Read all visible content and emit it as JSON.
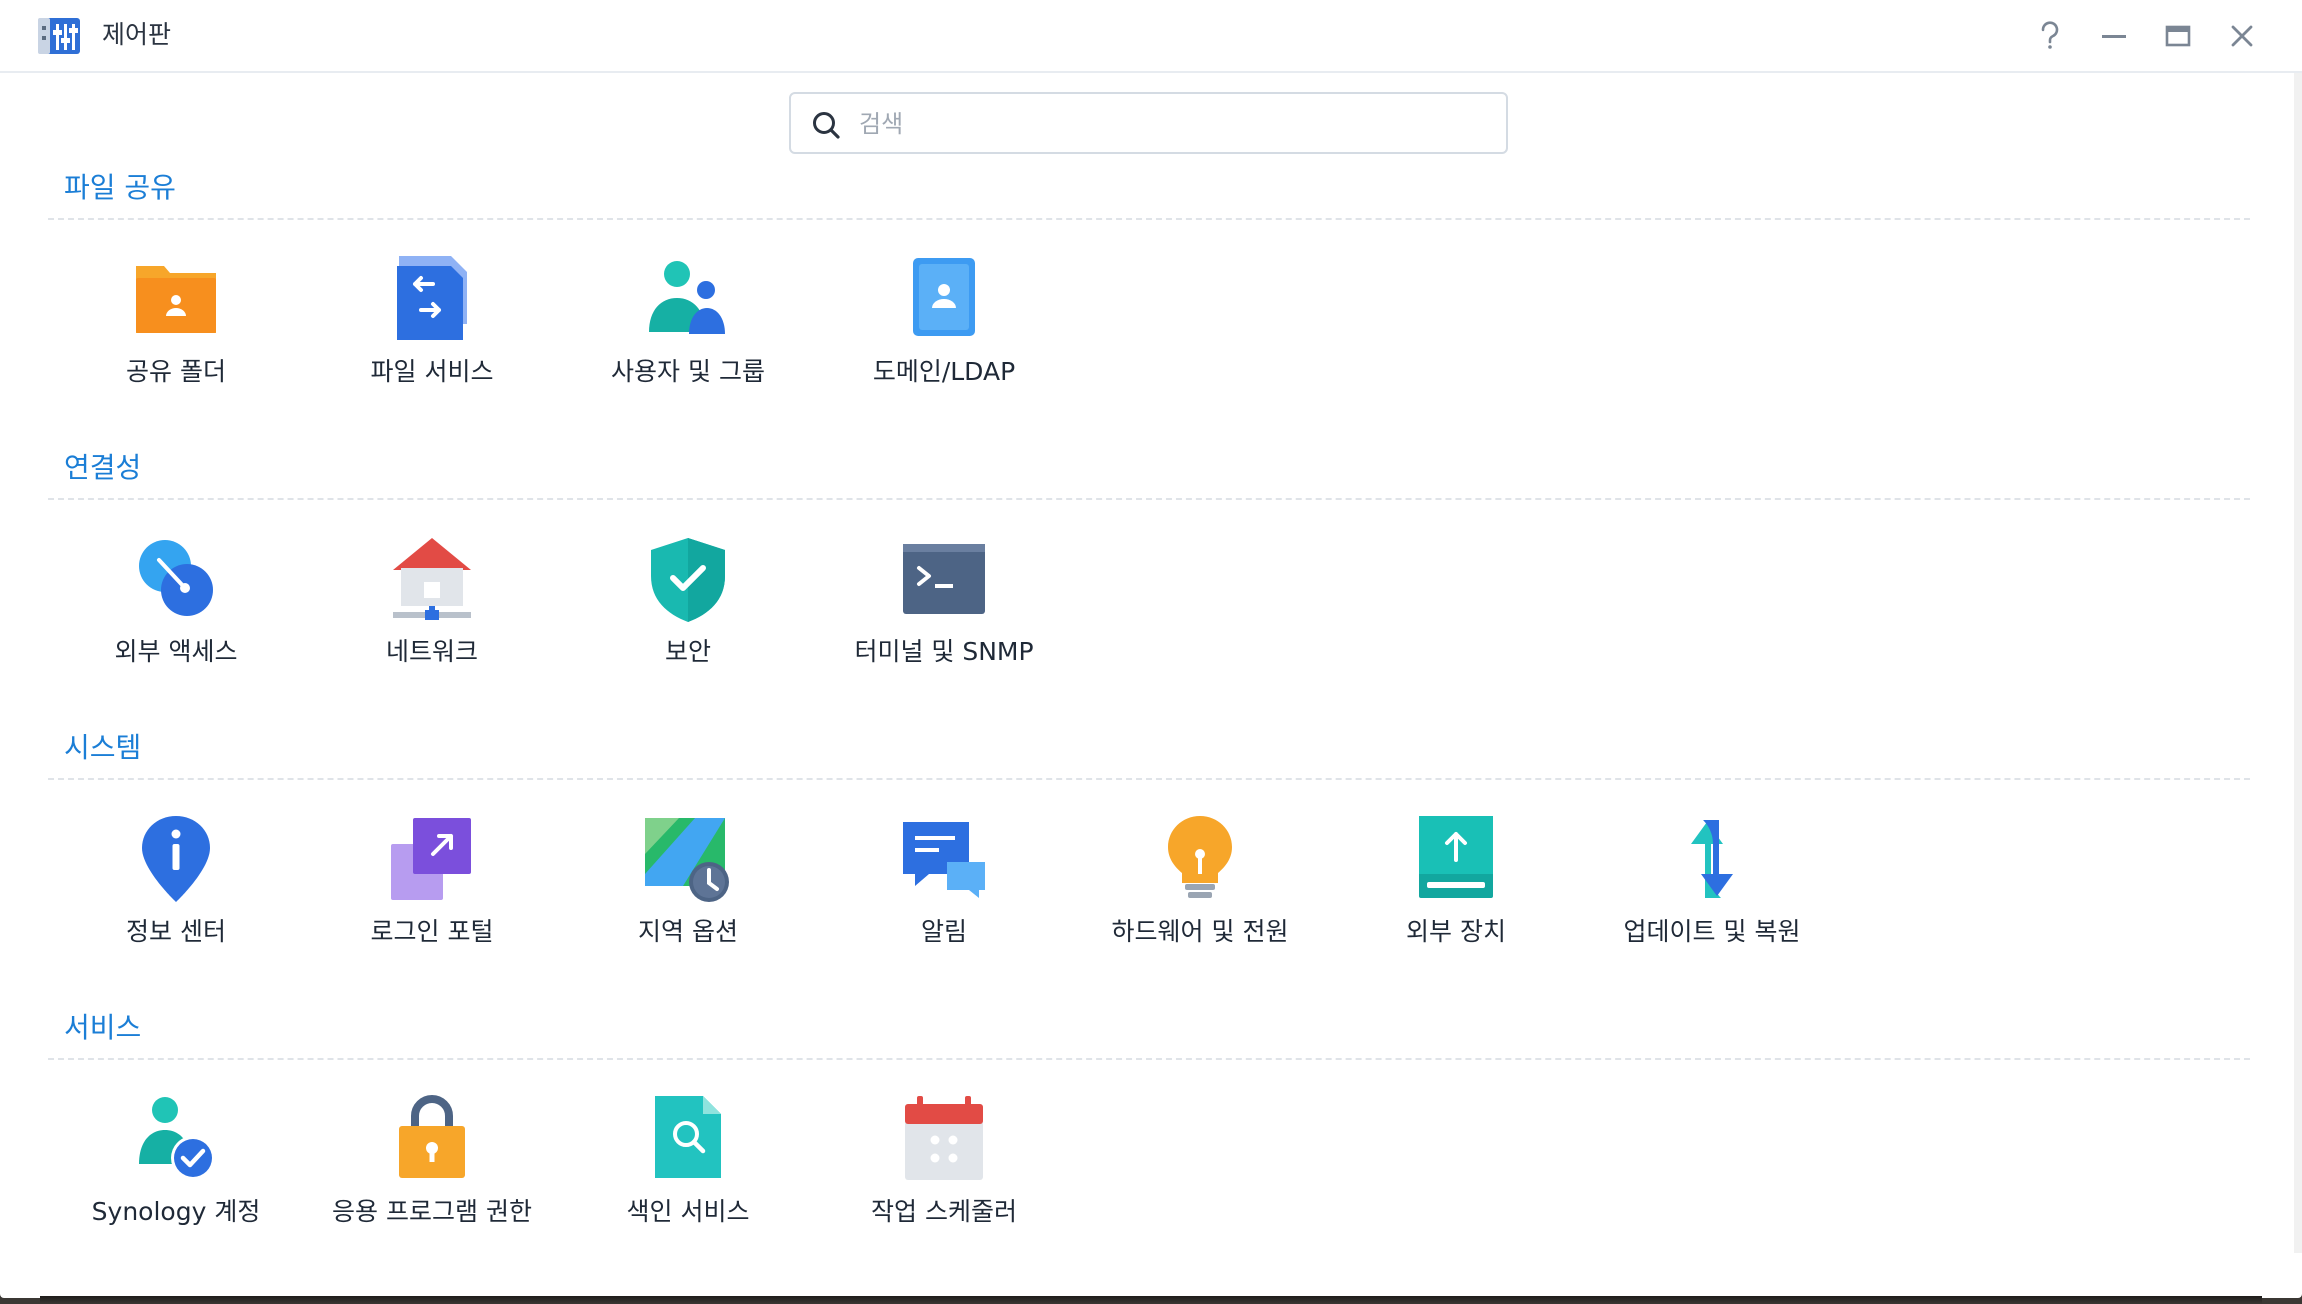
{
  "window": {
    "title": "제어판",
    "controls": [
      "help-icon",
      "minimize-icon",
      "maximize-icon",
      "close-icon"
    ]
  },
  "search": {
    "placeholder": "검색",
    "value": ""
  },
  "sections": [
    {
      "title": "파일 공유",
      "items": [
        {
          "label": "공유 폴더",
          "icon": "shared-folder-icon"
        },
        {
          "label": "파일 서비스",
          "icon": "file-services-icon"
        },
        {
          "label": "사용자 및 그룹",
          "icon": "user-group-icon"
        },
        {
          "label": "도메인/LDAP",
          "icon": "domain-ldap-icon"
        }
      ]
    },
    {
      "title": "연결성",
      "items": [
        {
          "label": "외부 액세스",
          "icon": "external-access-icon"
        },
        {
          "label": "네트워크",
          "icon": "network-icon"
        },
        {
          "label": "보안",
          "icon": "security-shield-icon"
        },
        {
          "label": "터미널 및 SNMP",
          "icon": "terminal-icon"
        }
      ]
    },
    {
      "title": "시스템",
      "items": [
        {
          "label": "정보 센터",
          "icon": "info-center-icon"
        },
        {
          "label": "로그인 포털",
          "icon": "login-portal-icon"
        },
        {
          "label": "지역 옵션",
          "icon": "regional-options-icon"
        },
        {
          "label": "알림",
          "icon": "notification-icon"
        },
        {
          "label": "하드웨어 및 전원",
          "icon": "hardware-power-icon"
        },
        {
          "label": "외부 장치",
          "icon": "external-devices-icon"
        },
        {
          "label": "업데이트 및 복원",
          "icon": "update-restore-icon"
        }
      ]
    },
    {
      "title": "서비스",
      "items": [
        {
          "label": "Synology 계정",
          "icon": "synology-account-icon"
        },
        {
          "label": "응용 프로그램 권한",
          "icon": "app-privileges-icon"
        },
        {
          "label": "색인 서비스",
          "icon": "indexing-service-icon"
        },
        {
          "label": "작업 스케줄러",
          "icon": "task-scheduler-icon"
        }
      ]
    }
  ],
  "colors": {
    "accent": "#1b7ed6",
    "section_title": "#1b7ed6",
    "label": "#1f2937"
  }
}
